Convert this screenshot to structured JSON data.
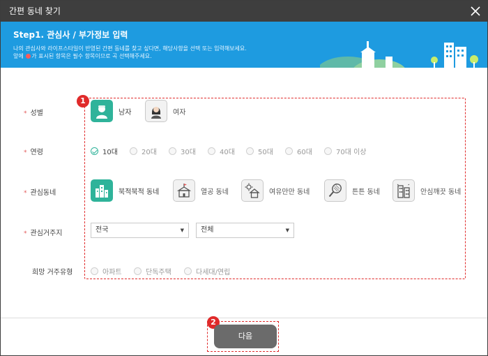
{
  "window": {
    "title": "간편 동네 찾기"
  },
  "banner": {
    "title": "Step1. 관심사 / 부가정보 입력",
    "desc1": "나의 관심사와 라이프스타일이 반영된 간편 동네를 찾고 싶다면, 해당사항을 선택 또는 입력해보세요.",
    "desc2_prefix": "앞에",
    "desc2_suffix": "가 표시된 항목은 필수 항목이므로 곡 선택해주세요."
  },
  "markers": {
    "first": "1",
    "second": "2"
  },
  "labels": {
    "required_mark": "*",
    "gender": "성별",
    "age": "연령",
    "interest": "관심동네",
    "residence": "관심거주지",
    "housing": "희망 거주유형"
  },
  "gender": {
    "options": [
      "남자",
      "여자"
    ],
    "selected": "남자"
  },
  "age": {
    "options": [
      "10대",
      "20대",
      "30대",
      "40대",
      "50대",
      "60대",
      "70대 이상"
    ],
    "selected": "10대"
  },
  "interest": {
    "options": [
      {
        "label": "북적북적 동네",
        "icon": "buildings-icon"
      },
      {
        "label": "열공 동네",
        "icon": "school-icon"
      },
      {
        "label": "여유만만 동네",
        "icon": "house-sun-icon"
      },
      {
        "label": "튼튼 동네",
        "icon": "tennis-racket-icon"
      },
      {
        "label": "안심깨끗 동네",
        "icon": "apartment-icon"
      }
    ],
    "selected": "북적북적 동네"
  },
  "residence": {
    "city_value": "전국",
    "district_value": "전체"
  },
  "housing": {
    "options": [
      "아파트",
      "단독주택",
      "다세대/연립"
    ],
    "selected": null
  },
  "footer": {
    "next_label": "다음"
  },
  "colors": {
    "accent": "#2fb39a",
    "banner": "#1e9be0",
    "titlebar": "#3e3e3e",
    "highlight": "#e02a2a"
  }
}
